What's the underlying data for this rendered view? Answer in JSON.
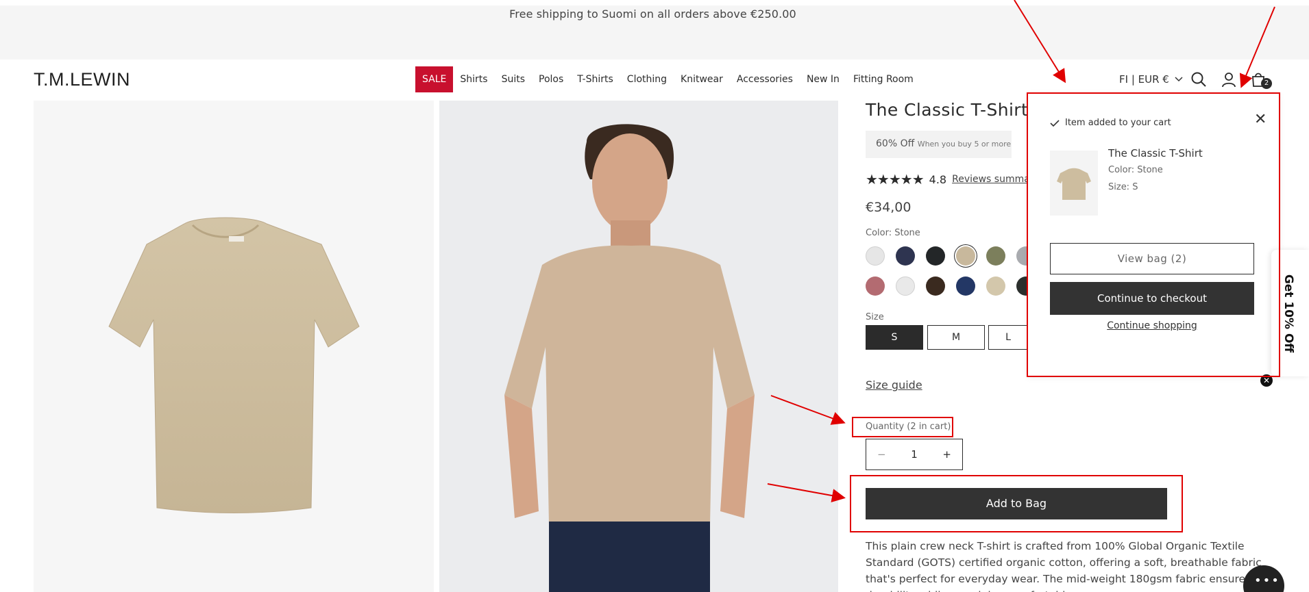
{
  "announcement": "Free shipping to Suomi on all orders above €250.00",
  "header": {
    "logo": "T.M.LEWIN",
    "nav": [
      "SALE",
      "Shirts",
      "Suits",
      "Polos",
      "T-Shirts",
      "Clothing",
      "Knitwear",
      "Accessories",
      "New In",
      "Fitting Room"
    ],
    "currency": "FI | EUR €",
    "cart_count": "2"
  },
  "product": {
    "title": "The Classic T-Shirt",
    "promo_main": "60% Off",
    "promo_sub": "When you buy 5 or more",
    "rating": "4.8",
    "stars": "★★★★★",
    "reviews_link": "Reviews summary",
    "price": "€34,00",
    "color_label": "Color: Stone",
    "size_label": "Size",
    "sizes": [
      "S",
      "M",
      "L"
    ],
    "size_guide": "Size guide",
    "quantity_label": "Quantity (2 in cart)",
    "quantity_value": "1",
    "qty_minus": "−",
    "qty_plus": "+",
    "add_to_bag": "Add to Bag",
    "description": "This plain crew neck T-shirt is crafted from 100% Global Organic Textile Standard (GOTS) certified organic cotton, offering a soft, breathable fabric that's perfect for everyday wear. The mid-weight 180gsm fabric ensures durability while remaining comfortable."
  },
  "swatch_colors": {
    "row1": [
      "#e6e6e6",
      "#2e3450",
      "#232628",
      "#c8b89c",
      "#7c7f5c",
      "#a9abaf"
    ],
    "row2": [
      "#b36b71",
      "#e9e9e9",
      "#3a2a1f",
      "#233765",
      "#d3c7ab",
      "#2b2f2d"
    ]
  },
  "cart_popup": {
    "added_text": "Item added to your cart",
    "item_name": "The Classic T-Shirt",
    "item_color": "Color: Stone",
    "item_size": "Size: S",
    "view_bag": "View bag (2)",
    "checkout": "Continue to checkout",
    "continue_shopping": "Continue shopping",
    "close_icon": "✕"
  },
  "side_tab": {
    "text": "Get 10% Off",
    "close": "✕"
  },
  "colors": {
    "sale": "#c8102e",
    "annotation_red": "#e00000",
    "button_dark": "#333333"
  }
}
